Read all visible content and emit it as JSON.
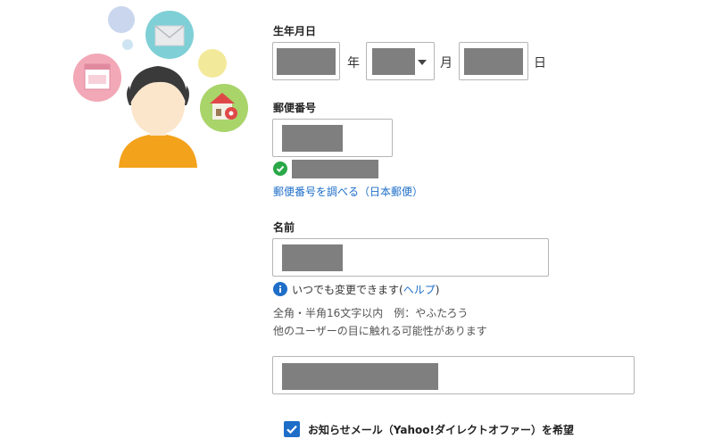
{
  "form": {
    "birthday": {
      "label": "生年月日",
      "year_unit": "年",
      "month_unit": "月",
      "day_unit": "日"
    },
    "postal": {
      "label": "郵便番号",
      "lookup_link": "郵便番号を調べる（日本郵便）"
    },
    "name": {
      "label": "名前",
      "info_text": "いつでも変更できます(",
      "help_link": "ヘルプ",
      "info_close": ")",
      "hint_line1": "全角・半角16文字以内　例：やふたろう",
      "hint_line2": "他のユーザーの目に触れる可能性があります"
    },
    "newsletter": {
      "checked": true,
      "label": "お知らせメール（Yahoo!ダイレクトオファー）を希望"
    }
  },
  "colors": {
    "accent": "#1e6ec8",
    "success": "#2aa848",
    "redaction": "#7f7f7f"
  }
}
